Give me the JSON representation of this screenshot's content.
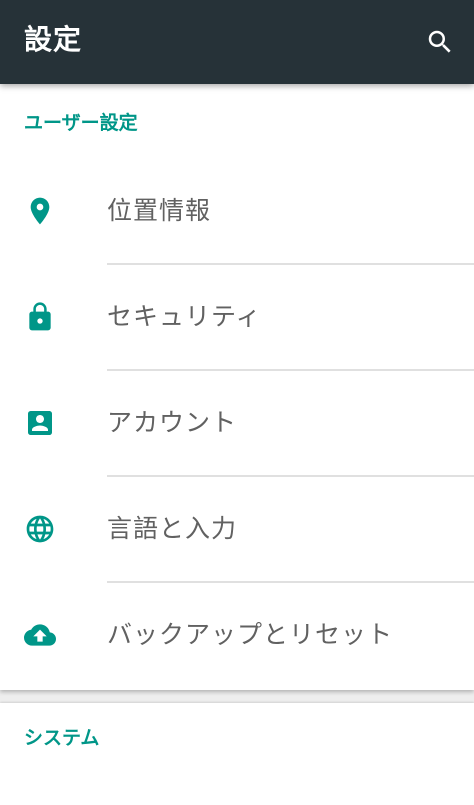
{
  "toolbar": {
    "title": "設定",
    "search_icon": "search-icon"
  },
  "sections": [
    {
      "header": "ユーザー設定",
      "items": [
        {
          "label": "位置情報",
          "icon": "location-pin-icon"
        },
        {
          "label": "セキュリティ",
          "icon": "lock-icon"
        },
        {
          "label": "アカウント",
          "icon": "account-box-icon"
        },
        {
          "label": "言語と入力",
          "icon": "globe-icon"
        },
        {
          "label": "バックアップとリセット",
          "icon": "cloud-upload-icon"
        }
      ]
    },
    {
      "header": "システム",
      "items": []
    }
  ],
  "colors": {
    "toolbar": "#263238",
    "accent": "#009688",
    "text": "#616161",
    "background": "#eeeeee",
    "divider": "#e0e0e0"
  }
}
